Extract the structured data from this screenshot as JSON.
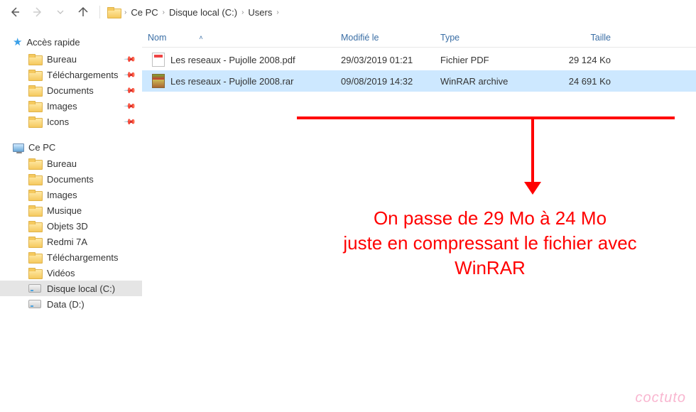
{
  "breadcrumb": [
    "Ce PC",
    "Disque local (C:)",
    "Users"
  ],
  "sidebar": {
    "quick": {
      "title": "Accès rapide",
      "items": [
        "Bureau",
        "Téléchargements",
        "Documents",
        "Images",
        "Icons"
      ]
    },
    "pc": {
      "title": "Ce PC",
      "items": [
        "Bureau",
        "Documents",
        "Images",
        "Musique",
        "Objets 3D",
        "Redmi 7A",
        "Téléchargements",
        "Vidéos",
        "Disque local (C:)",
        "Data (D:)"
      ]
    }
  },
  "columns": {
    "name": "Nom",
    "modified": "Modifié le",
    "type": "Type",
    "size": "Taille"
  },
  "files": [
    {
      "name": "Les reseaux - Pujolle 2008.pdf",
      "modified": "29/03/2019 01:21",
      "type": "Fichier PDF",
      "size": "29 124 Ko",
      "kind": "pdf",
      "selected": false
    },
    {
      "name": "Les reseaux - Pujolle 2008.rar",
      "modified": "09/08/2019 14:32",
      "type": "WinRAR archive",
      "size": "24 691 Ko",
      "kind": "rar",
      "selected": true
    }
  ],
  "annotation": {
    "line1": "On passe de 29 Mo à 24 Mo",
    "line2": "juste en compressant le fichier avec WinRAR"
  },
  "watermark": "coctuto"
}
